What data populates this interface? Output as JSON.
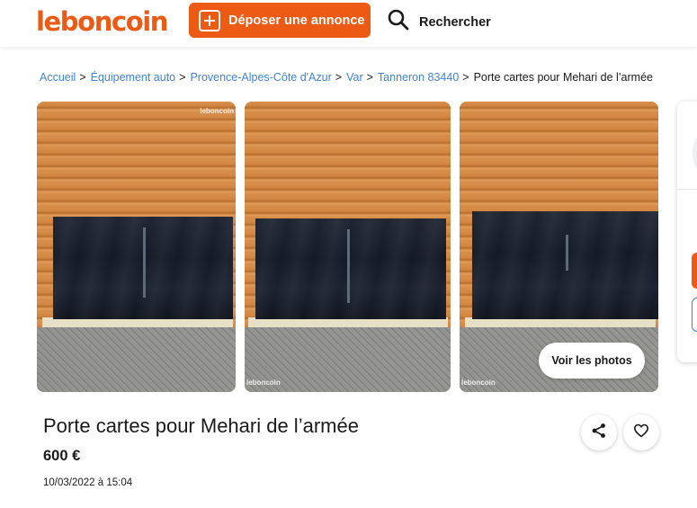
{
  "header": {
    "logo": "leboncoin",
    "deposer_label": "Déposer une annonce",
    "search_label": "Rechercher"
  },
  "breadcrumb": {
    "items": [
      "Accueil",
      "Équipement auto",
      "Provence-Alpes-Côte d'Azur",
      "Var",
      "Tanneron 83440"
    ],
    "separator": ">",
    "current": "Porte cartes pour Mehari de l’armée"
  },
  "gallery": {
    "watermark": "leboncoin",
    "voir_photos_label": "Voir les photos"
  },
  "listing": {
    "title": "Porte cartes pour Mehari de l’armée",
    "price": "600 €",
    "date": "10/03/2022 à 15:04"
  },
  "colors": {
    "brand": "#ec5a13",
    "link": "#4183d7"
  },
  "icons": {
    "plus": "plus-square-icon",
    "search": "magnifier-icon",
    "share": "share-icon",
    "favorite": "heart-icon"
  }
}
